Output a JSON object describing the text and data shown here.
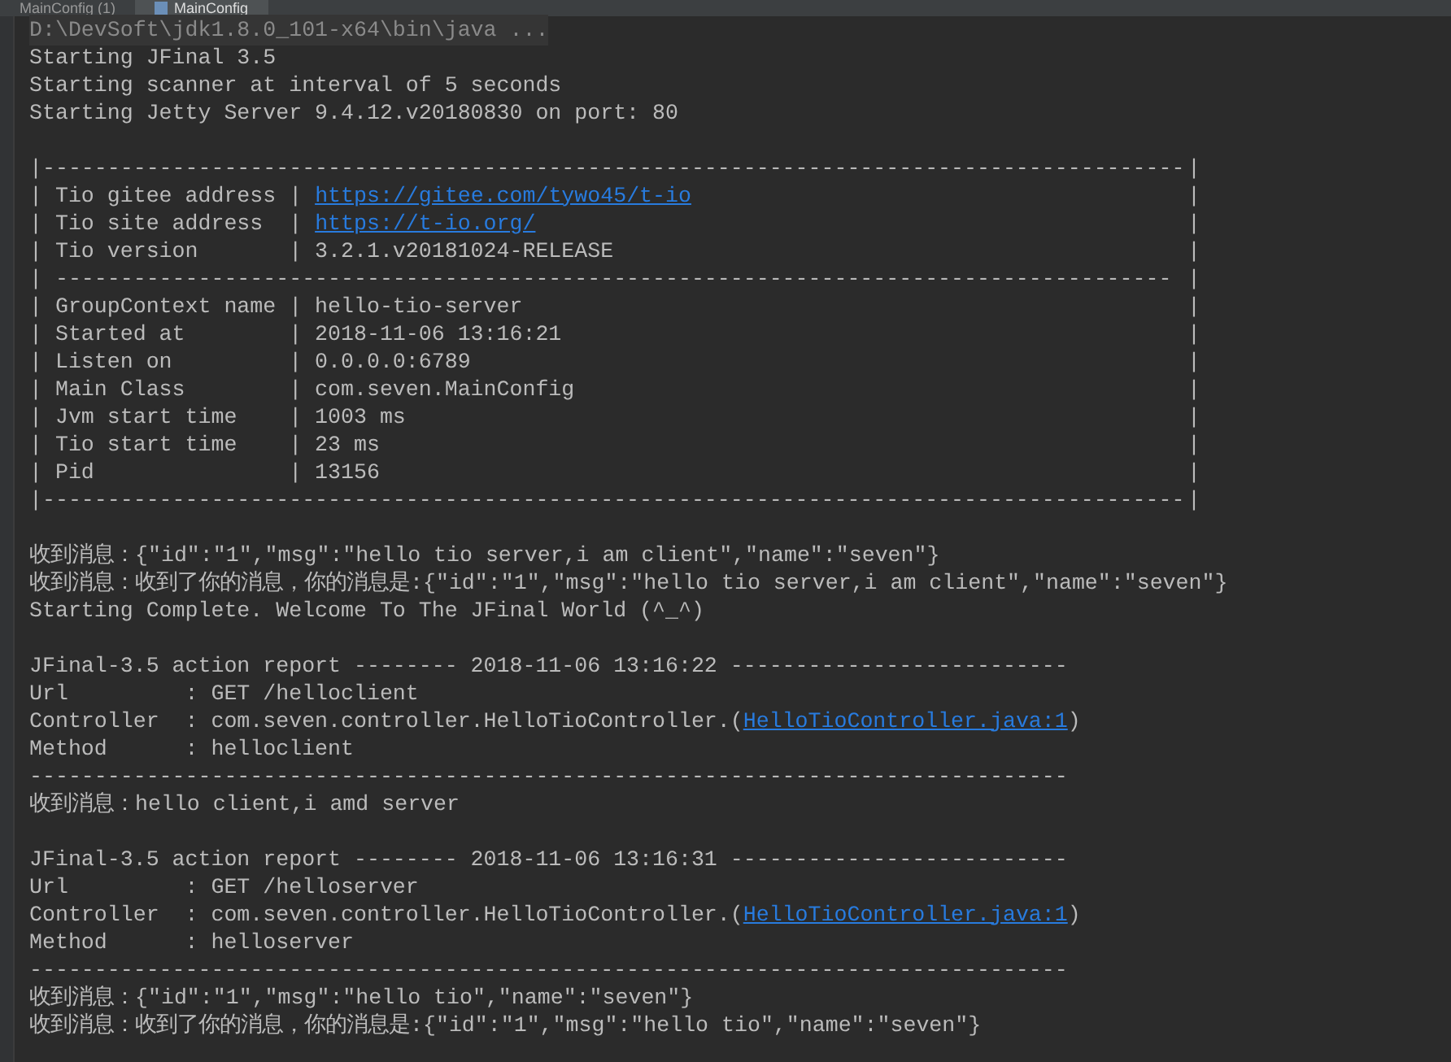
{
  "tabs": [
    {
      "label": "MainConfig (1)",
      "selected": false
    },
    {
      "label": "MainConfig",
      "selected": true
    }
  ],
  "console": {
    "lines": [
      {
        "kind": "command",
        "segments": [
          {
            "kind": "text",
            "text": "D:\\DevSoft\\jdk1.8.0_101-x64\\bin\\java ..."
          }
        ]
      },
      {
        "kind": "output",
        "segments": [
          {
            "kind": "text",
            "text": "Starting JFinal 3.5"
          }
        ]
      },
      {
        "kind": "output",
        "segments": [
          {
            "kind": "text",
            "text": "Starting scanner at interval of 5 seconds"
          }
        ]
      },
      {
        "kind": "output",
        "segments": [
          {
            "kind": "text",
            "text": "Starting Jetty Server 9.4.12.v20180830 on port: 80"
          }
        ]
      },
      {
        "kind": "blank"
      },
      {
        "kind": "box_row",
        "segments": [
          {
            "kind": "text",
            "text": "|----------------------------------------------------------------------------------------"
          }
        ],
        "end": "|"
      },
      {
        "kind": "box_row",
        "segments": [
          {
            "kind": "text",
            "text": "| Tio gitee address | "
          },
          {
            "kind": "link",
            "text": "https://gitee.com/tywo45/t-io"
          }
        ],
        "end": "|"
      },
      {
        "kind": "box_row",
        "segments": [
          {
            "kind": "text",
            "text": "| Tio site address  | "
          },
          {
            "kind": "link",
            "text": "https://t-io.org/"
          }
        ],
        "end": "|"
      },
      {
        "kind": "box_row",
        "segments": [
          {
            "kind": "text",
            "text": "| Tio version       | 3.2.1.v20181024-RELEASE"
          }
        ],
        "end": "|"
      },
      {
        "kind": "box_row",
        "segments": [
          {
            "kind": "text",
            "text": "| --------------------------------------------------------------------------------------"
          }
        ],
        "end": "|"
      },
      {
        "kind": "box_row",
        "segments": [
          {
            "kind": "text",
            "text": "| GroupContext name | hello-tio-server"
          }
        ],
        "end": "|"
      },
      {
        "kind": "box_row",
        "segments": [
          {
            "kind": "text",
            "text": "| Started at        | 2018-11-06 13:16:21"
          }
        ],
        "end": "|"
      },
      {
        "kind": "box_row",
        "segments": [
          {
            "kind": "text",
            "text": "| Listen on         | 0.0.0.0:6789"
          }
        ],
        "end": "|"
      },
      {
        "kind": "box_row",
        "segments": [
          {
            "kind": "text",
            "text": "| Main Class        | com.seven.MainConfig"
          }
        ],
        "end": "|"
      },
      {
        "kind": "box_row",
        "segments": [
          {
            "kind": "text",
            "text": "| Jvm start time    | 1003 ms"
          }
        ],
        "end": "|"
      },
      {
        "kind": "box_row",
        "segments": [
          {
            "kind": "text",
            "text": "| Tio start time    | 23 ms"
          }
        ],
        "end": "|"
      },
      {
        "kind": "box_row",
        "segments": [
          {
            "kind": "text",
            "text": "| Pid               | 13156"
          }
        ],
        "end": "|"
      },
      {
        "kind": "box_row",
        "segments": [
          {
            "kind": "text",
            "text": "|----------------------------------------------------------------------------------------"
          }
        ],
        "end": "|"
      },
      {
        "kind": "blank"
      },
      {
        "kind": "output",
        "segments": [
          {
            "kind": "text",
            "text": "收到消息：{\"id\":\"1\",\"msg\":\"hello tio server,i am client\",\"name\":\"seven\"}"
          }
        ]
      },
      {
        "kind": "output",
        "segments": [
          {
            "kind": "text",
            "text": "收到消息：收到了你的消息，你的消息是:{\"id\":\"1\",\"msg\":\"hello tio server,i am client\",\"name\":\"seven\"}"
          }
        ]
      },
      {
        "kind": "output",
        "segments": [
          {
            "kind": "text",
            "text": "Starting Complete. Welcome To The JFinal World (^_^)"
          }
        ]
      },
      {
        "kind": "blank"
      },
      {
        "kind": "output",
        "segments": [
          {
            "kind": "text",
            "text": "JFinal-3.5 action report -------- 2018-11-06 13:16:22 --------------------------"
          }
        ]
      },
      {
        "kind": "output",
        "segments": [
          {
            "kind": "text",
            "text": "Url         : GET /helloclient"
          }
        ]
      },
      {
        "kind": "output",
        "segments": [
          {
            "kind": "text",
            "text": "Controller  : com.seven.controller.HelloTioController.("
          },
          {
            "kind": "link",
            "text": "HelloTioController.java:1"
          },
          {
            "kind": "text",
            "text": ")"
          }
        ]
      },
      {
        "kind": "output",
        "segments": [
          {
            "kind": "text",
            "text": "Method      : helloclient"
          }
        ]
      },
      {
        "kind": "output",
        "segments": [
          {
            "kind": "text",
            "text": "--------------------------------------------------------------------------------"
          }
        ]
      },
      {
        "kind": "output",
        "segments": [
          {
            "kind": "text",
            "text": "收到消息：hello client,i amd server"
          }
        ]
      },
      {
        "kind": "blank"
      },
      {
        "kind": "output",
        "segments": [
          {
            "kind": "text",
            "text": "JFinal-3.5 action report -------- 2018-11-06 13:16:31 --------------------------"
          }
        ]
      },
      {
        "kind": "output",
        "segments": [
          {
            "kind": "text",
            "text": "Url         : GET /helloserver"
          }
        ]
      },
      {
        "kind": "output",
        "segments": [
          {
            "kind": "text",
            "text": "Controller  : com.seven.controller.HelloTioController.("
          },
          {
            "kind": "link",
            "text": "HelloTioController.java:1"
          },
          {
            "kind": "text",
            "text": ")"
          }
        ]
      },
      {
        "kind": "output",
        "segments": [
          {
            "kind": "text",
            "text": "Method      : helloserver"
          }
        ]
      },
      {
        "kind": "output",
        "segments": [
          {
            "kind": "text",
            "text": "--------------------------------------------------------------------------------"
          }
        ]
      },
      {
        "kind": "output",
        "segments": [
          {
            "kind": "text",
            "text": "收到消息：{\"id\":\"1\",\"msg\":\"hello tio\",\"name\":\"seven\"}"
          }
        ]
      },
      {
        "kind": "output",
        "segments": [
          {
            "kind": "text",
            "text": "收到消息：收到了你的消息，你的消息是:{\"id\":\"1\",\"msg\":\"hello tio\",\"name\":\"seven\"}"
          }
        ]
      }
    ]
  }
}
